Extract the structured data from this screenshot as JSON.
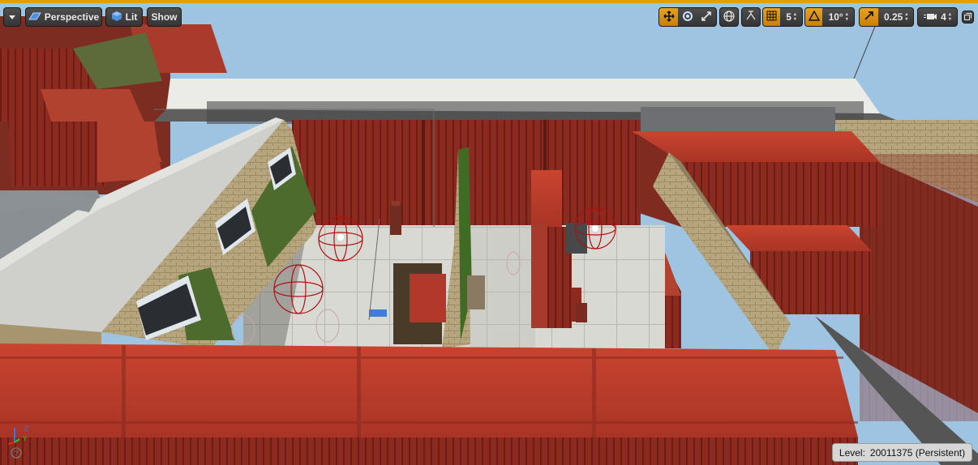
{
  "toolbar": {
    "menu_icon": "chevron-down-icon",
    "perspective_label": "Perspective",
    "lit_label": "Lit",
    "show_label": "Show",
    "grid_value": "5",
    "rotation_value": "10°",
    "scale_value": "0.25",
    "camera_speed_value": "4"
  },
  "level_status": {
    "label": "Level:",
    "value": "20011375 (Persistent)"
  },
  "axis": {
    "y_label": "Y",
    "z_label": "Z"
  },
  "colors": {
    "accent": "#e7a224",
    "container_red": "#9c2f22",
    "sky": "#9fc4e2"
  }
}
